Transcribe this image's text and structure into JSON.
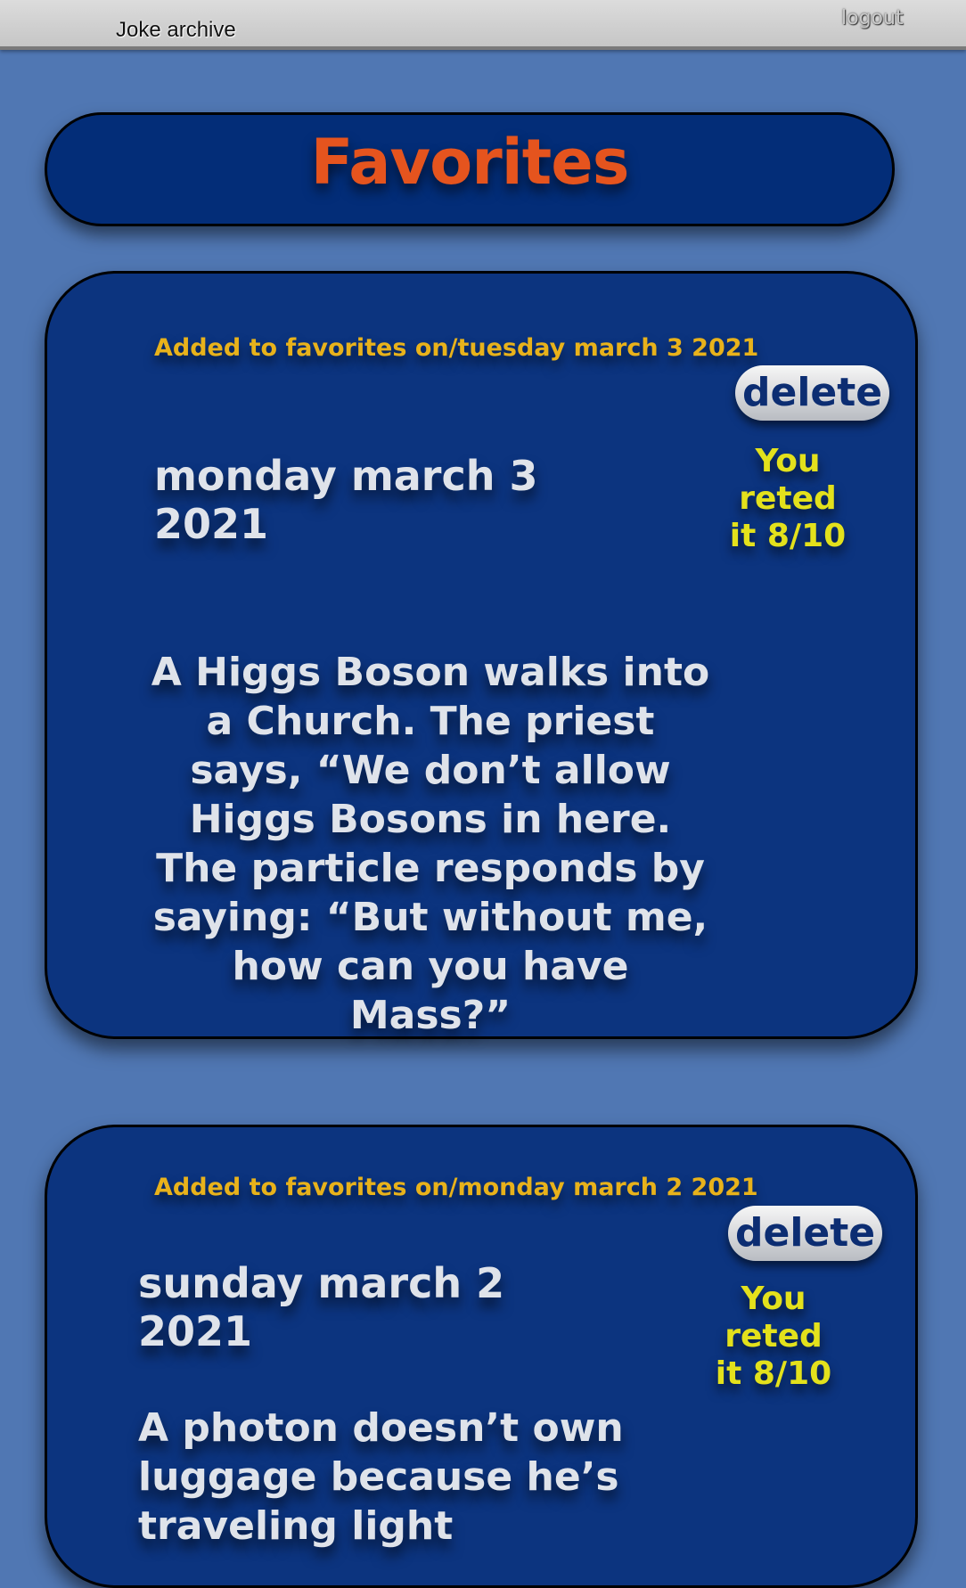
{
  "topbar": {
    "app_title": "Joke archive",
    "logout_label": "logout"
  },
  "header": {
    "title": "Favorites"
  },
  "favorites": [
    {
      "added_text": "Added to favorites on/tuesday march 3 2021",
      "date": "monday march 3 2021",
      "delete_label": "delete",
      "rating_text": "You reted it 8/10",
      "joke": "A Higgs Boson walks into a Church. The priest says, “We don’t allow Higgs Bosons in here. The particle responds by saying: “But without me, how can you have Mass?”"
    },
    {
      "added_text": "Added to favorites on/monday march 2 2021",
      "date": "sunday march 2 2021",
      "delete_label": "delete",
      "rating_text": "You reted it 8/10",
      "joke": "A photon doesn’t own luggage because he’s traveling light"
    }
  ],
  "colors": {
    "background": "#5077b3",
    "card": "#0c347f",
    "title_orange": "#e5541e",
    "added_gold": "#e8b21b",
    "rating_yellow": "#e3e11c",
    "text_light": "#dfe3ea"
  }
}
